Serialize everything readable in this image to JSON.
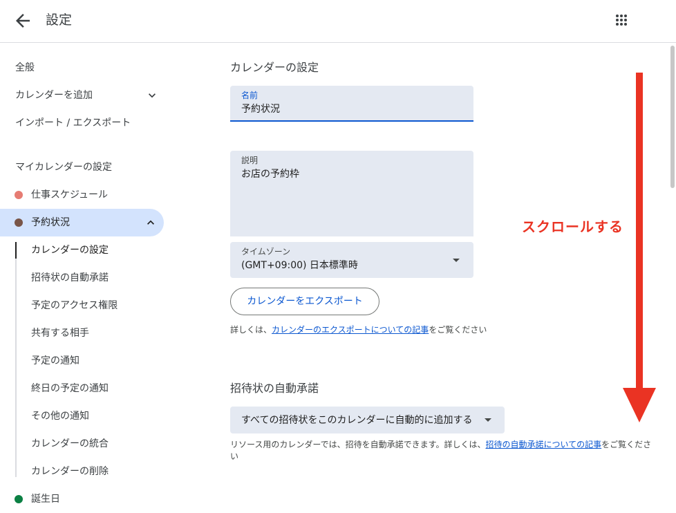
{
  "header": {
    "back_icon": "arrow-back-icon",
    "title": "設定",
    "apps_icon": "apps-grid-icon"
  },
  "sidebar": {
    "general": "全般",
    "add_calendar": "カレンダーを追加",
    "import_export": "インポート / エクスポート",
    "my_calendars_heading": "マイカレンダーの設定",
    "calendars": [
      {
        "label": "仕事スケジュール",
        "color": "#e67c73"
      },
      {
        "label": "予約状況",
        "color": "#795548"
      }
    ],
    "sub_items": [
      "カレンダーの設定",
      "招待状の自動承諾",
      "予定のアクセス権限",
      "共有する相手",
      "予定の通知",
      "終日の予定の通知",
      "その他の通知",
      "カレンダーの統合",
      "カレンダーの削除"
    ],
    "birthday": {
      "label": "誕生日",
      "color": "#0b8043"
    }
  },
  "main": {
    "calendar_settings_heading": "カレンダーの設定",
    "name_field": {
      "label": "名前",
      "value": "予約状況"
    },
    "description_field": {
      "label": "説明",
      "value": "お店の予約枠"
    },
    "timezone_field": {
      "label": "タイムゾーン",
      "value": "(GMT+09:00) 日本標準時"
    },
    "export_button": "カレンダーをエクスポート",
    "export_help": {
      "prefix": "詳しくは、",
      "link": "カレンダーのエクスポートについての記事",
      "suffix": "をご覧ください"
    },
    "auto_accept_heading": "招待状の自動承諾",
    "auto_accept_dropdown": "すべての招待状をこのカレンダーに自動的に追加する",
    "auto_accept_help": {
      "prefix": "リソース用のカレンダーでは、招待を自動承諾できます。詳しくは、",
      "link": "招待の自動承諾についての記事",
      "suffix": "をご覧ください"
    }
  },
  "annotation": {
    "text": "スクロールする",
    "color": "#ea3323"
  },
  "colors": {
    "accent": "#0b57d0",
    "field_bg": "#e4e9f2",
    "active_nav_bg": "#d3e3fd"
  }
}
